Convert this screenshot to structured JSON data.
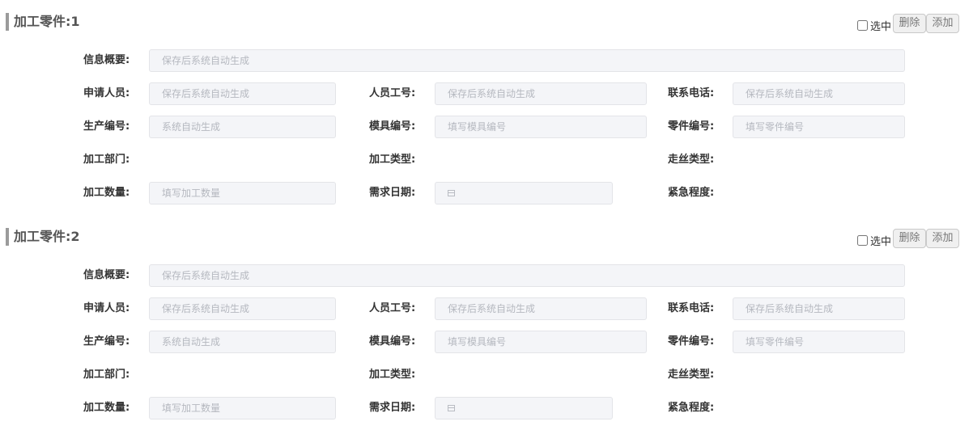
{
  "parts": [
    {
      "title": "加工零件:1",
      "select_label": "选中",
      "delete_label": "删除",
      "add_label": "添加",
      "fields": {
        "info_summary": {
          "label": "信息概要:",
          "placeholder": "保存后系统自动生成"
        },
        "applicant": {
          "label": "申请人员:",
          "placeholder": "保存后系统自动生成"
        },
        "employee_no": {
          "label": "人员工号:",
          "placeholder": "保存后系统自动生成"
        },
        "phone": {
          "label": "联系电话:",
          "placeholder": "保存后系统自动生成"
        },
        "production_no": {
          "label": "生产编号:",
          "placeholder": "系统自动生成"
        },
        "mold_no": {
          "label": "模具编号:",
          "placeholder": "填写模具编号"
        },
        "part_no": {
          "label": "零件编号:",
          "placeholder": "填写零件编号"
        },
        "dept": {
          "label": "加工部门:"
        },
        "proc_type": {
          "label": "加工类型:"
        },
        "wire_type": {
          "label": "走丝类型:"
        },
        "quantity": {
          "label": "加工数量:",
          "placeholder": "填写加工数量"
        },
        "need_date": {
          "label": "需求日期:",
          "icon": "calendar-icon"
        },
        "urgency": {
          "label": "紧急程度:"
        }
      }
    },
    {
      "title": "加工零件:2",
      "select_label": "选中",
      "delete_label": "删除",
      "add_label": "添加",
      "fields": {
        "info_summary": {
          "label": "信息概要:",
          "placeholder": "保存后系统自动生成"
        },
        "applicant": {
          "label": "申请人员:",
          "placeholder": "保存后系统自动生成"
        },
        "employee_no": {
          "label": "人员工号:",
          "placeholder": "保存后系统自动生成"
        },
        "phone": {
          "label": "联系电话:",
          "placeholder": "保存后系统自动生成"
        },
        "production_no": {
          "label": "生产编号:",
          "placeholder": "系统自动生成"
        },
        "mold_no": {
          "label": "模具编号:",
          "placeholder": "填写模具编号"
        },
        "part_no": {
          "label": "零件编号:",
          "placeholder": "填写零件编号"
        },
        "dept": {
          "label": "加工部门:"
        },
        "proc_type": {
          "label": "加工类型:"
        },
        "wire_type": {
          "label": "走丝类型:"
        },
        "quantity": {
          "label": "加工数量:",
          "placeholder": "填写加工数量"
        },
        "need_date": {
          "label": "需求日期:",
          "icon": "calendar-icon"
        },
        "urgency": {
          "label": "紧急程度:"
        }
      }
    }
  ]
}
